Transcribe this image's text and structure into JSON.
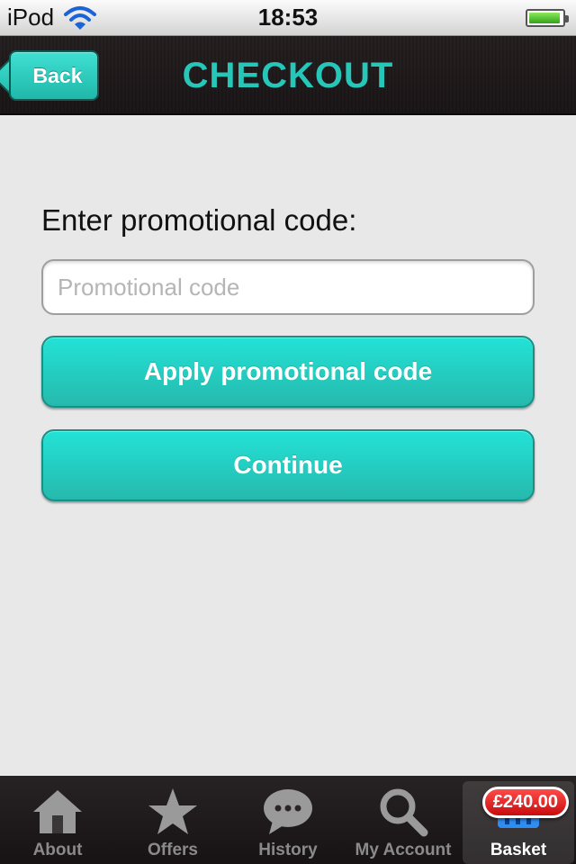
{
  "status_bar": {
    "carrier": "iPod",
    "time": "18:53",
    "battery_level": 0.95
  },
  "nav": {
    "back_label": "Back",
    "title": "CHECKOUT"
  },
  "form": {
    "label": "Enter promotional code:",
    "input_value": "",
    "input_placeholder": "Promotional code",
    "apply_label": "Apply promotional code",
    "continue_label": "Continue"
  },
  "tabs": {
    "items": [
      {
        "label": "About",
        "icon": "house-icon"
      },
      {
        "label": "Offers",
        "icon": "star-icon"
      },
      {
        "label": "History",
        "icon": "speech-bubble-icon"
      },
      {
        "label": "My Account",
        "icon": "magnifier-icon"
      },
      {
        "label": "Basket",
        "icon": "basket-icon",
        "active": true
      }
    ],
    "basket_badge": "£240.00"
  },
  "colors": {
    "accent": "#26c6b8",
    "button_top": "#23e2d6",
    "button_bottom": "#26b9ad",
    "badge": "#d81515"
  }
}
